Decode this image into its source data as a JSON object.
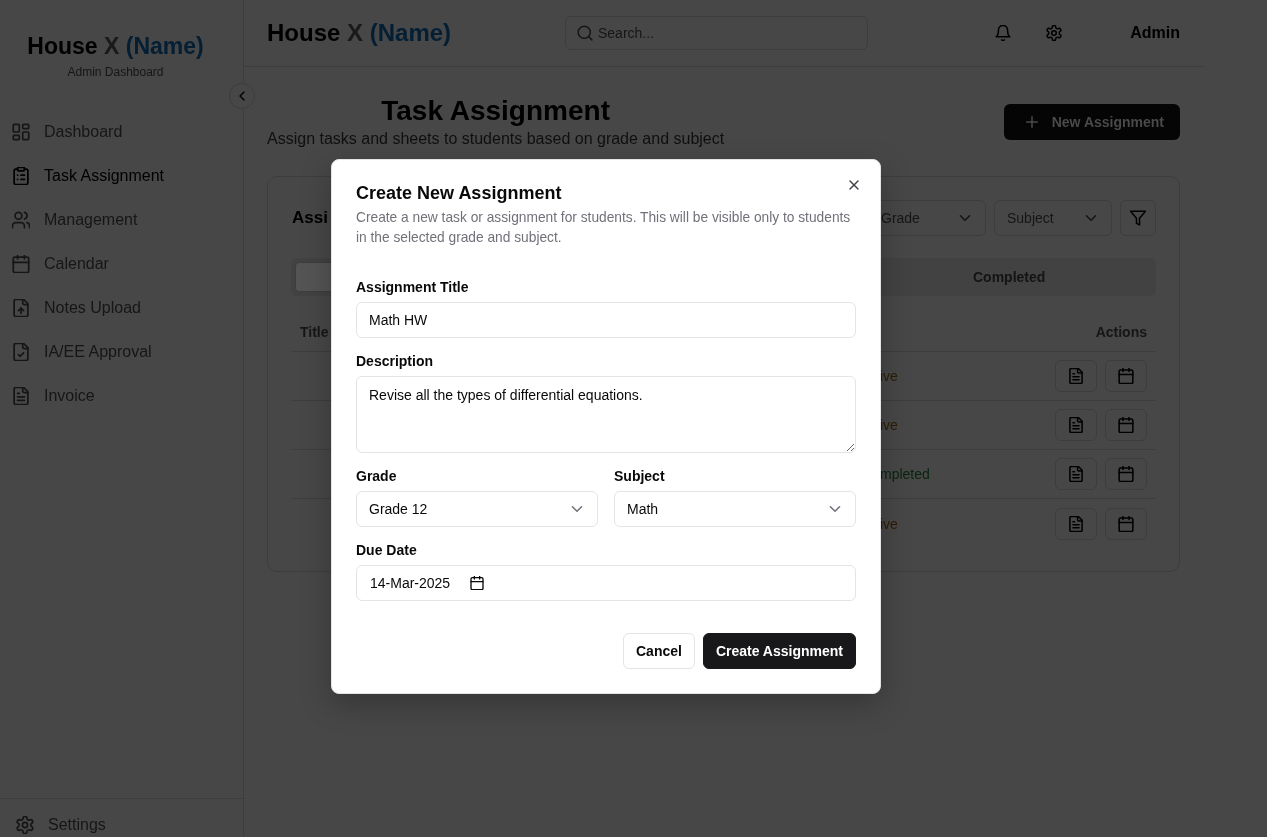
{
  "sidebar": {
    "brand": {
      "word": "House",
      "letter": "X",
      "name": "(Name)"
    },
    "subtitle": "Admin Dashboard",
    "items": [
      {
        "label": "Dashboard",
        "selected": false
      },
      {
        "label": "Task Assignment",
        "selected": true
      },
      {
        "label": "Management",
        "selected": false
      },
      {
        "label": "Calendar",
        "selected": false
      },
      {
        "label": "Notes Upload",
        "selected": false
      },
      {
        "label": "IA/EE Approval",
        "selected": false
      },
      {
        "label": "Invoice",
        "selected": false
      }
    ],
    "footer_item": {
      "label": "Settings"
    }
  },
  "header": {
    "brand": {
      "word": "House",
      "letter": "X",
      "name": "(Name)"
    },
    "search": {
      "placeholder": "Search..."
    },
    "user": "Admin"
  },
  "page": {
    "title": "Task Assignment",
    "subtitle": "Assign tasks and sheets to students based on grade and subject",
    "new_button": "New Assignment"
  },
  "card": {
    "title": "Assi",
    "filters": [
      {
        "placeholder": "Grade"
      },
      {
        "placeholder": "Subject"
      }
    ],
    "tabs": [
      {
        "selected": true
      },
      {
        "label": "Completed",
        "selected": false
      }
    ],
    "table": {
      "columns": [
        "Title",
        "Actions"
      ],
      "rows": [
        {
          "status": "ive",
          "color": "#2e1b03"
        },
        {
          "status": "ive",
          "color": "#2e1b03"
        },
        {
          "status": "mpleted",
          "color": "#082410"
        },
        {
          "status": "ive",
          "color": "#2e1b03"
        }
      ]
    }
  },
  "dialog": {
    "title": "Create New Assignment",
    "description": "Create a new task or assignment for students. This will be visible only to students in the selected grade and subject.",
    "fields": [
      {
        "kind": "text",
        "label": "Assignment Title",
        "value": "Math HW"
      },
      {
        "kind": "textarea",
        "label": "Description",
        "value": "Revise all the types of differential equations."
      },
      {
        "kind": "select",
        "label": "Grade",
        "value": "Grade 12"
      },
      {
        "kind": "select",
        "label": "Subject",
        "value": "Math"
      },
      {
        "kind": "date",
        "label": "Due Date",
        "value": "14-Mar-2025"
      }
    ],
    "buttons": [
      {
        "label": "Cancel",
        "kind": "secondary"
      },
      {
        "label": "Create Assignment",
        "kind": "primary"
      }
    ]
  }
}
